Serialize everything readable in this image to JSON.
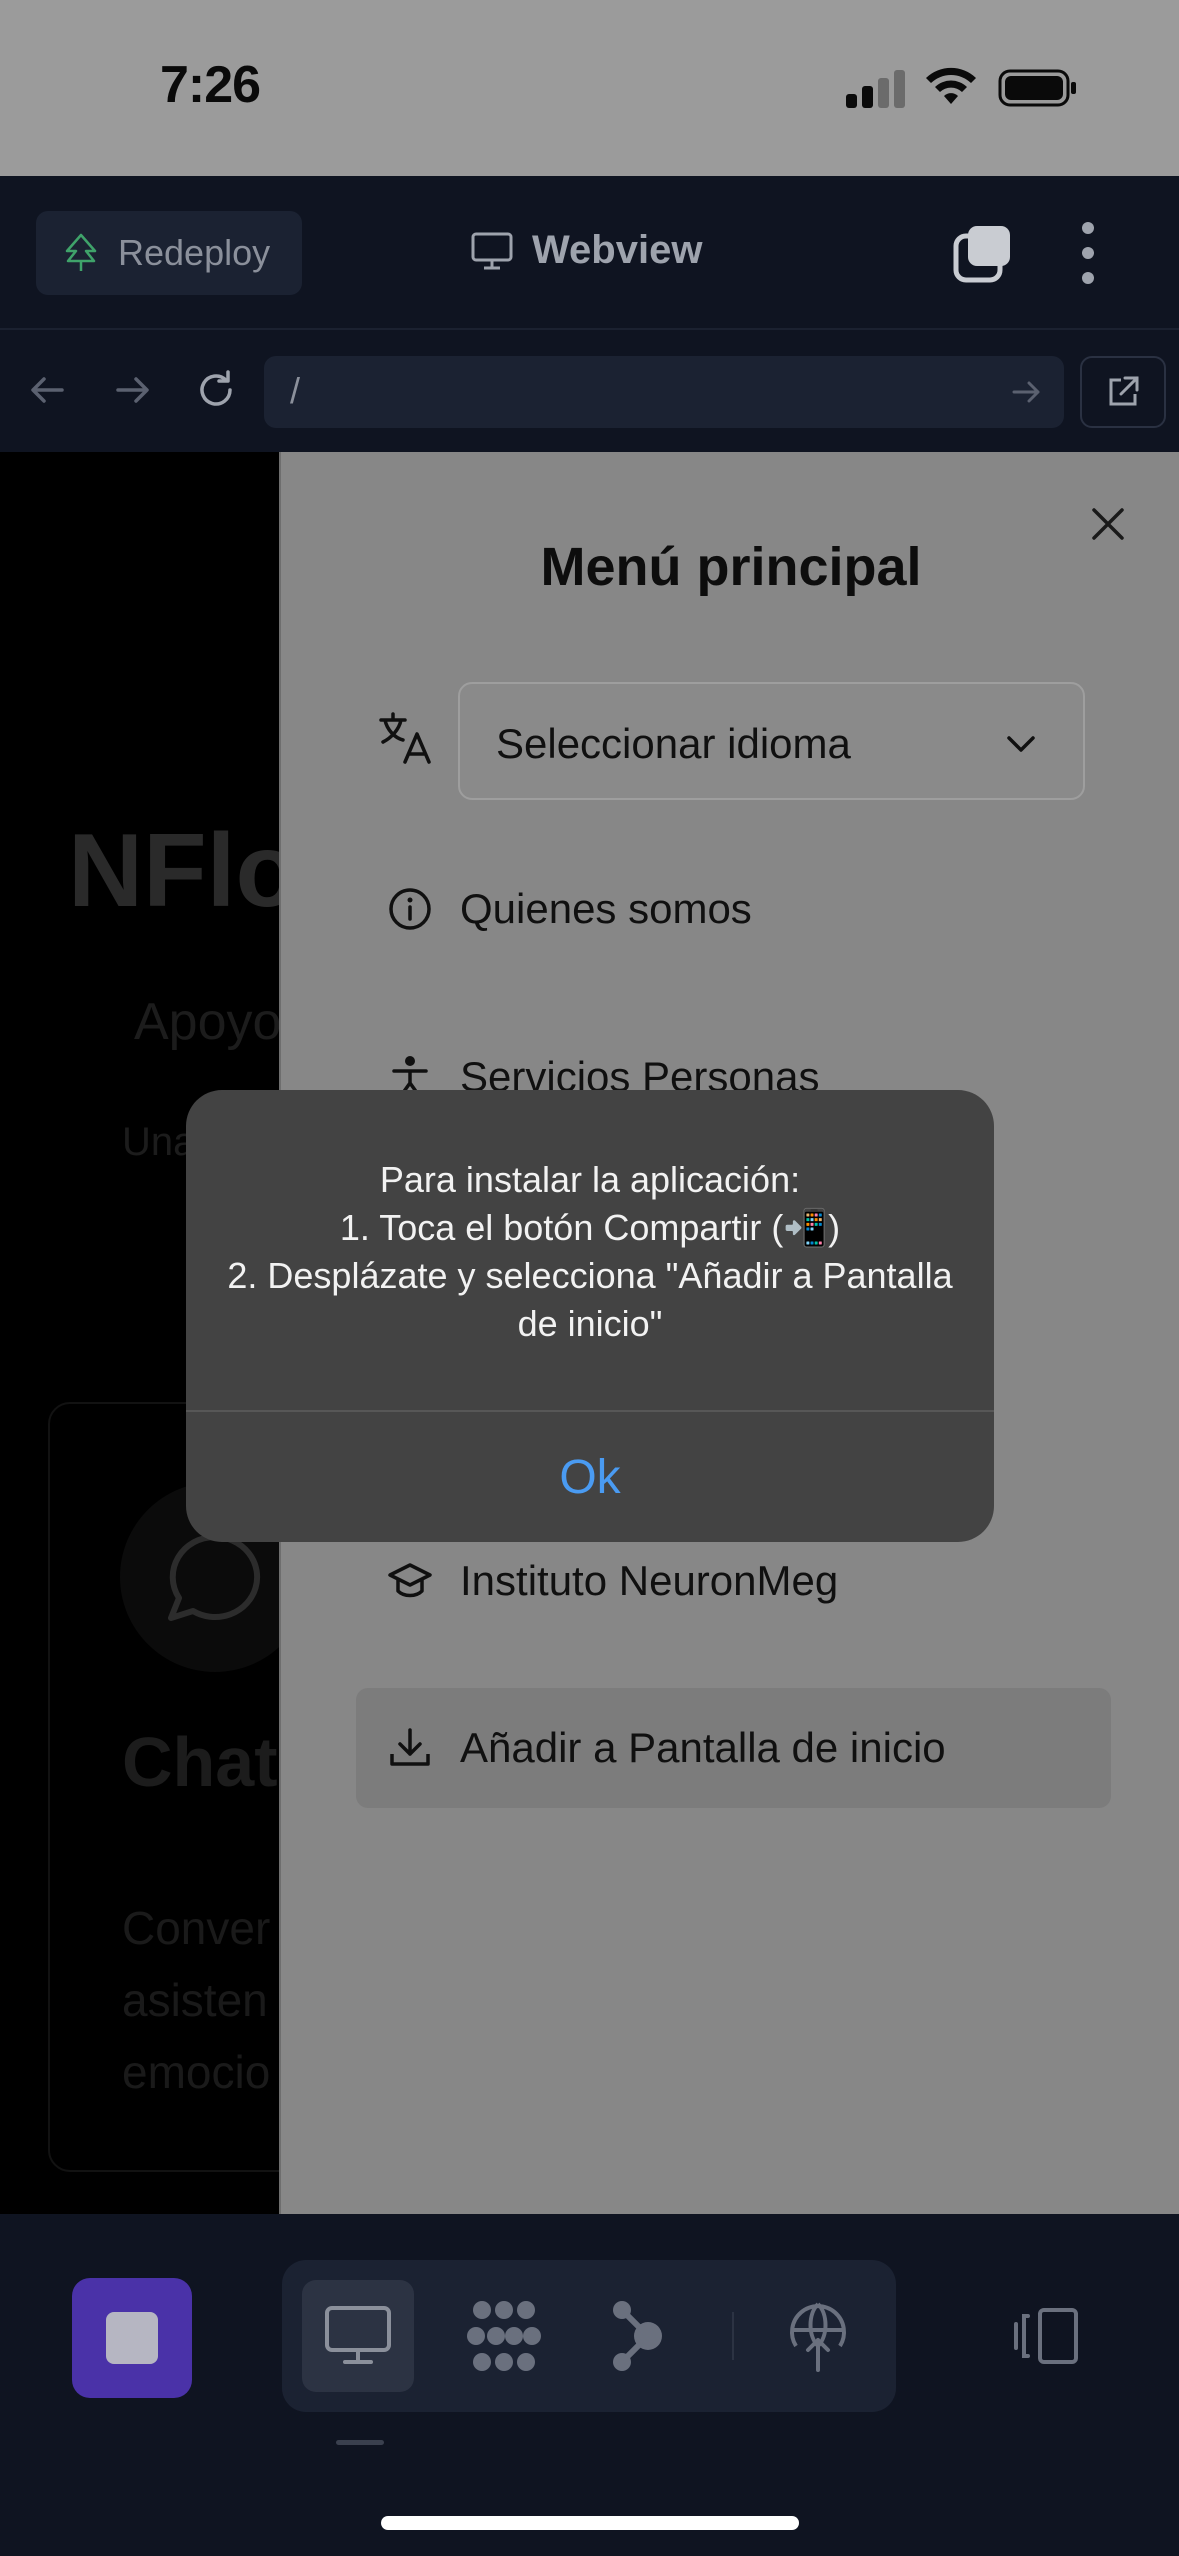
{
  "status_bar": {
    "time": "7:26"
  },
  "top_bar": {
    "redeploy_label": "Redeploy",
    "title": "Webview"
  },
  "url_bar": {
    "value": "/"
  },
  "page": {
    "title": "NFlo",
    "subtitle": "Apoyo",
    "description": "Una en",
    "card": {
      "title": "Chat",
      "text": "Conver asisten emocio"
    }
  },
  "menu": {
    "title": "Menú principal",
    "language_select": "Seleccionar idioma",
    "items": [
      {
        "label": "Quienes somos",
        "icon": "info-icon"
      },
      {
        "label": "Servicios Personas",
        "icon": "person-icon"
      },
      {
        "label": "Instituto NeuronMeg",
        "icon": "graduation-cap-icon"
      },
      {
        "label": "Añadir a Pantalla de inicio",
        "icon": "download-icon"
      }
    ]
  },
  "alert": {
    "message": "Para instalar la aplicación:\n1. Toca el botón Compartir (📲)\n2. Desplázate y selecciona \"Añadir a Pantalla de inicio\"",
    "ok_label": "Ok"
  },
  "colors": {
    "toolbar_bg": "#0f1421",
    "accent_purple": "#4a32a8",
    "alert_link": "#4a9bf2"
  }
}
